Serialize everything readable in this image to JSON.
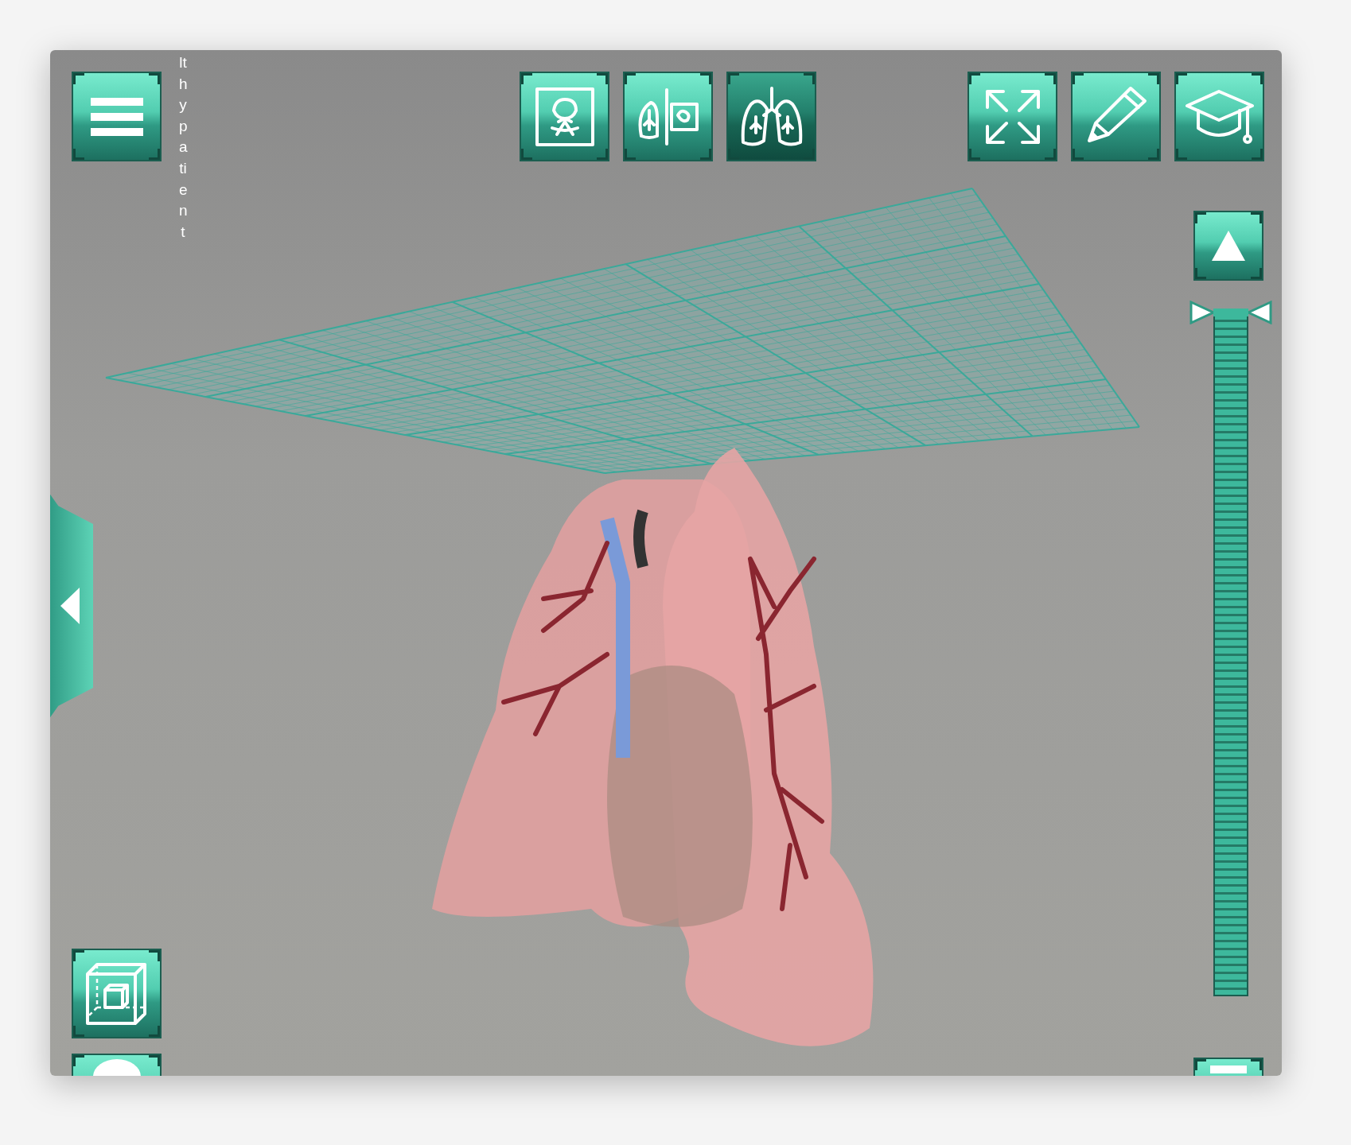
{
  "patient_label": "lthypatient",
  "view_modes": [
    {
      "kind": "scan",
      "selected": false
    },
    {
      "kind": "split",
      "selected": false
    },
    {
      "kind": "lungs",
      "selected": true
    }
  ],
  "zoom_slider": {
    "level": 1
  }
}
